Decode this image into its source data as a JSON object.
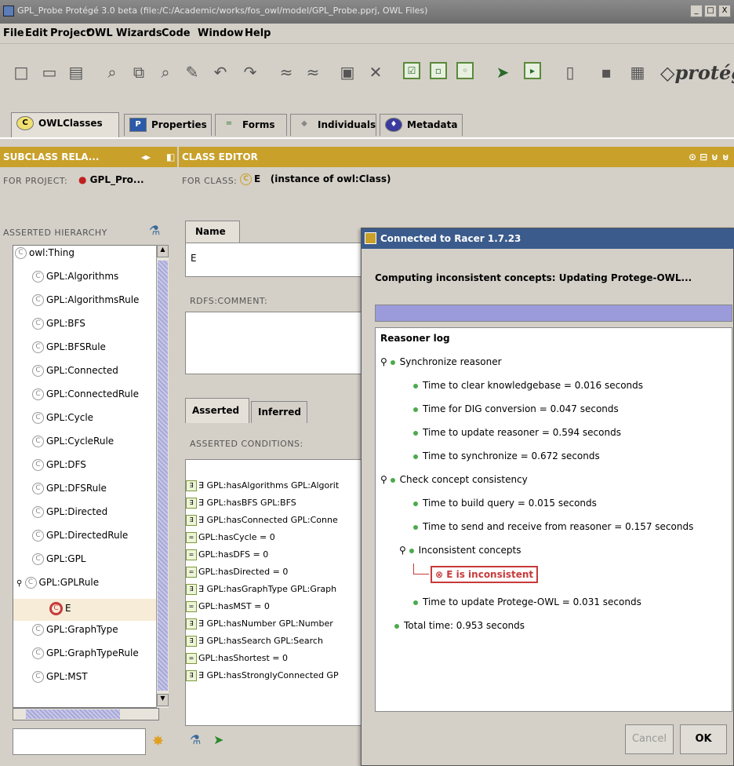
{
  "window": {
    "title": "GPL_Probe Protégé 3.0 beta   (file:/C:/Academic/works/fos_owl/model/GPL_Probe.pprj, OWL Files)",
    "minimize": "_",
    "maximize": "□",
    "close": "X"
  },
  "menu": [
    "File",
    "Edit",
    "Project",
    "OWL",
    "Wizards",
    "Code",
    "Window",
    "Help"
  ],
  "logo": "protégé",
  "tabs": [
    {
      "label": "OWLClasses",
      "icon": "C"
    },
    {
      "label": "Properties",
      "icon": "P"
    },
    {
      "label": "Forms",
      "icon": "="
    },
    {
      "label": "Individuals",
      "icon": "◆"
    },
    {
      "label": "Metadata",
      "icon": "♦"
    }
  ],
  "left": {
    "header": "SUBCLASS RELA...",
    "project_label": "FOR PROJECT:",
    "project_name": "GPL_Pro...",
    "hierarchy_label": "ASSERTED HIERARCHY",
    "tree": [
      "owl:Thing",
      "GPL:Algorithms",
      "GPL:AlgorithmsRule",
      "GPL:BFS",
      "GPL:BFSRule",
      "GPL:Connected",
      "GPL:ConnectedRule",
      "GPL:Cycle",
      "GPL:CycleRule",
      "GPL:DFS",
      "GPL:DFSRule",
      "GPL:Directed",
      "GPL:DirectedRule",
      "GPL:GPL",
      "GPL:GPLRule",
      "E",
      "GPL:GraphType",
      "GPL:GraphTypeRule",
      "GPL:MST"
    ]
  },
  "editor": {
    "header": "CLASS EDITOR",
    "for_class_label": "FOR CLASS:",
    "class_name": "E",
    "instance_of": "(instance of owl:Class)",
    "name_tab": "Name",
    "name_value": "E",
    "comment_label": "RDFS:COMMENT:",
    "cond_tabs": [
      "Asserted",
      "Inferred"
    ],
    "conditions_label": "ASSERTED CONDITIONS:",
    "conditions": [
      "∃ GPL:hasAlgorithms GPL:Algorit",
      "∃ GPL:hasBFS GPL:BFS",
      "∃ GPL:hasConnected GPL:Conne",
      "GPL:hasCycle = 0",
      "GPL:hasDFS = 0",
      "GPL:hasDirected = 0",
      "∃ GPL:hasGraphType GPL:Graph",
      "GPL:hasMST = 0",
      "∃ GPL:hasNumber GPL:Number",
      "∃ GPL:hasSearch GPL:Search",
      "GPL:hasShortest = 0",
      "∃ GPL:hasStronglyConnected GP"
    ]
  },
  "dialog": {
    "title": "Connected to Racer 1.7.23",
    "status": "Computing inconsistent concepts: Updating Protege-OWL...",
    "progress": 1.0,
    "log_label": "Reasoner log",
    "log": [
      {
        "text": "Synchronize reasoner",
        "indent": 0,
        "tree": true
      },
      {
        "text": "Time to clear knowledgebase = 0.016 seconds",
        "indent": 1
      },
      {
        "text": "Time for DIG conversion = 0.047 seconds",
        "indent": 1
      },
      {
        "text": "Time to update reasoner = 0.594 seconds",
        "indent": 1
      },
      {
        "text": "Time to synchronize = 0.672 seconds",
        "indent": 1
      },
      {
        "text": "Check concept consistency",
        "indent": 0,
        "tree": true
      },
      {
        "text": "Time to build query = 0.015 seconds",
        "indent": 1
      },
      {
        "text": "Time to send and receive from reasoner = 0.157 seconds",
        "indent": 1
      },
      {
        "text": "Inconsistent concepts",
        "indent": 1,
        "tree": true
      },
      {
        "text": "E is inconsistent",
        "indent": 2,
        "error": true
      },
      {
        "text": "Time to update Protege-OWL = 0.031 seconds",
        "indent": 1
      },
      {
        "text": "Total time: 0.953 seconds",
        "indent": 0
      }
    ],
    "cancel": "Cancel",
    "ok": "OK"
  }
}
